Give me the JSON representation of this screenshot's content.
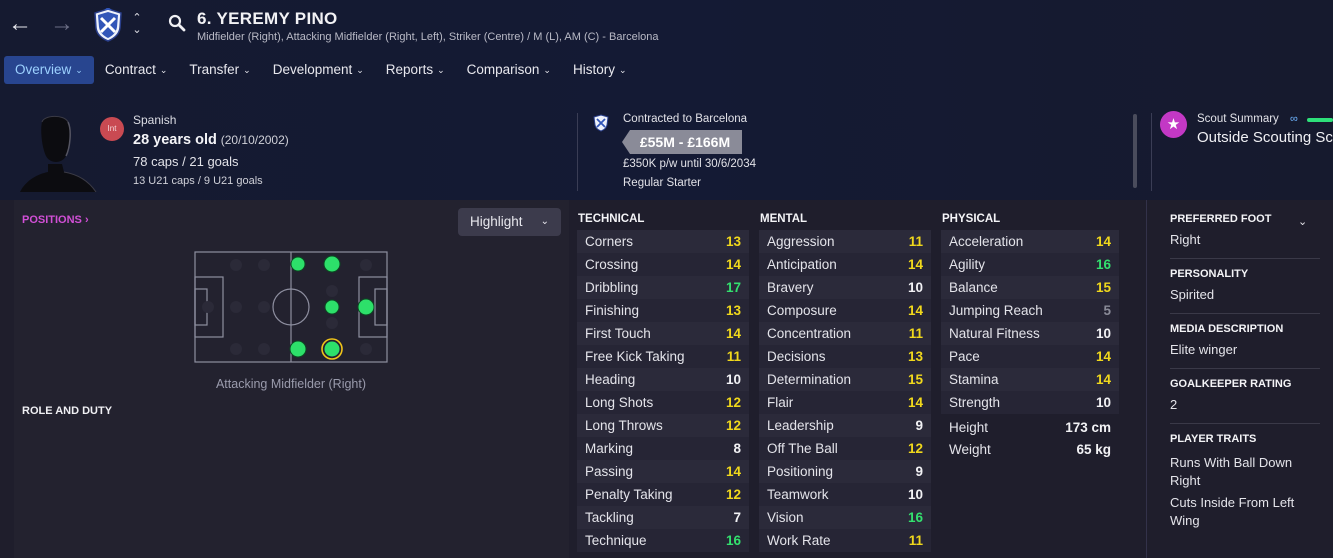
{
  "nav": {
    "back_icon": "arrow-left-icon",
    "forward_icon": "arrow-right-icon",
    "back_glyph": "←",
    "forward_glyph": "→",
    "up_glyph": "⌃",
    "down_glyph": "⌄"
  },
  "player": {
    "name": "6. YEREMY PINO",
    "positions_line": "Midfielder (Right), Attacking Midfielder (Right, Left), Striker (Centre) / M (L), AM (C) - Barcelona",
    "int_badge": "Int",
    "nationality": "Spanish",
    "age": "28 years old",
    "dob": "(20/10/2002)",
    "caps": "78 caps / 21 goals",
    "u21": "13 U21 caps / 9 U21 goals"
  },
  "tabs": [
    {
      "label": "Overview",
      "active": true
    },
    {
      "label": "Contract"
    },
    {
      "label": "Transfer"
    },
    {
      "label": "Development"
    },
    {
      "label": "Reports"
    },
    {
      "label": "Comparison"
    },
    {
      "label": "History"
    }
  ],
  "contract": {
    "title": "Contracted to Barcelona",
    "value_range": "£55M - £166M",
    "wage": "£350K p/w until 30/6/2034",
    "status": "Regular Starter"
  },
  "scout": {
    "label": "Scout Summary",
    "value": "Outside Scouting Sc"
  },
  "positions": {
    "title": "POSITIONS ›",
    "highlight_label": "Highlight",
    "caption": "Attacking Midfielder (Right)",
    "role_title": "ROLE AND DUTY"
  },
  "colors": {
    "accent_blue": "#28458f",
    "position_green": "#2de06a",
    "value_yellow": "#f0d81c",
    "value_green": "#33e06e",
    "scout_pink": "#c338c5",
    "int_red": "#c94a52"
  },
  "attributes": {
    "technical": {
      "title": "TECHNICAL",
      "rows": [
        {
          "name": "Corners",
          "value": "13",
          "tone": "yellow"
        },
        {
          "name": "Crossing",
          "value": "14",
          "tone": "yellow"
        },
        {
          "name": "Dribbling",
          "value": "17",
          "tone": "green"
        },
        {
          "name": "Finishing",
          "value": "13",
          "tone": "yellow"
        },
        {
          "name": "First Touch",
          "value": "14",
          "tone": "yellow"
        },
        {
          "name": "Free Kick Taking",
          "value": "11",
          "tone": "yellow"
        },
        {
          "name": "Heading",
          "value": "10",
          "tone": "white"
        },
        {
          "name": "Long Shots",
          "value": "12",
          "tone": "yellow"
        },
        {
          "name": "Long Throws",
          "value": "12",
          "tone": "yellow"
        },
        {
          "name": "Marking",
          "value": "8",
          "tone": "white"
        },
        {
          "name": "Passing",
          "value": "14",
          "tone": "yellow"
        },
        {
          "name": "Penalty Taking",
          "value": "12",
          "tone": "yellow"
        },
        {
          "name": "Tackling",
          "value": "7",
          "tone": "white"
        },
        {
          "name": "Technique",
          "value": "16",
          "tone": "green"
        }
      ]
    },
    "mental": {
      "title": "MENTAL",
      "rows": [
        {
          "name": "Aggression",
          "value": "11",
          "tone": "yellow"
        },
        {
          "name": "Anticipation",
          "value": "14",
          "tone": "yellow"
        },
        {
          "name": "Bravery",
          "value": "10",
          "tone": "white"
        },
        {
          "name": "Composure",
          "value": "14",
          "tone": "yellow"
        },
        {
          "name": "Concentration",
          "value": "11",
          "tone": "yellow"
        },
        {
          "name": "Decisions",
          "value": "13",
          "tone": "yellow"
        },
        {
          "name": "Determination",
          "value": "15",
          "tone": "yellow"
        },
        {
          "name": "Flair",
          "value": "14",
          "tone": "yellow"
        },
        {
          "name": "Leadership",
          "value": "9",
          "tone": "white"
        },
        {
          "name": "Off The Ball",
          "value": "12",
          "tone": "yellow"
        },
        {
          "name": "Positioning",
          "value": "9",
          "tone": "white"
        },
        {
          "name": "Teamwork",
          "value": "10",
          "tone": "white"
        },
        {
          "name": "Vision",
          "value": "16",
          "tone": "green"
        },
        {
          "name": "Work Rate",
          "value": "11",
          "tone": "yellow"
        }
      ]
    },
    "physical": {
      "title": "PHYSICAL",
      "rows": [
        {
          "name": "Acceleration",
          "value": "14",
          "tone": "yellow"
        },
        {
          "name": "Agility",
          "value": "16",
          "tone": "green"
        },
        {
          "name": "Balance",
          "value": "15",
          "tone": "yellow"
        },
        {
          "name": "Jumping Reach",
          "value": "5",
          "tone": "grey"
        },
        {
          "name": "Natural Fitness",
          "value": "10",
          "tone": "white"
        },
        {
          "name": "Pace",
          "value": "14",
          "tone": "yellow"
        },
        {
          "name": "Stamina",
          "value": "14",
          "tone": "yellow"
        },
        {
          "name": "Strength",
          "value": "10",
          "tone": "white"
        }
      ],
      "height_label": "Height",
      "height_value": "173 cm",
      "weight_label": "Weight",
      "weight_value": "65 kg"
    }
  },
  "info": {
    "foot_title": "PREFERRED FOOT",
    "foot_value": "Right",
    "personality_title": "PERSONALITY",
    "personality_value": "Spirited",
    "media_title": "MEDIA DESCRIPTION",
    "media_value": "Elite winger",
    "gk_title": "GOALKEEPER RATING",
    "gk_value": "2",
    "traits_title": "PLAYER TRAITS",
    "traits": [
      "Runs With Ball Down Right",
      "Cuts Inside From Left Wing"
    ]
  }
}
